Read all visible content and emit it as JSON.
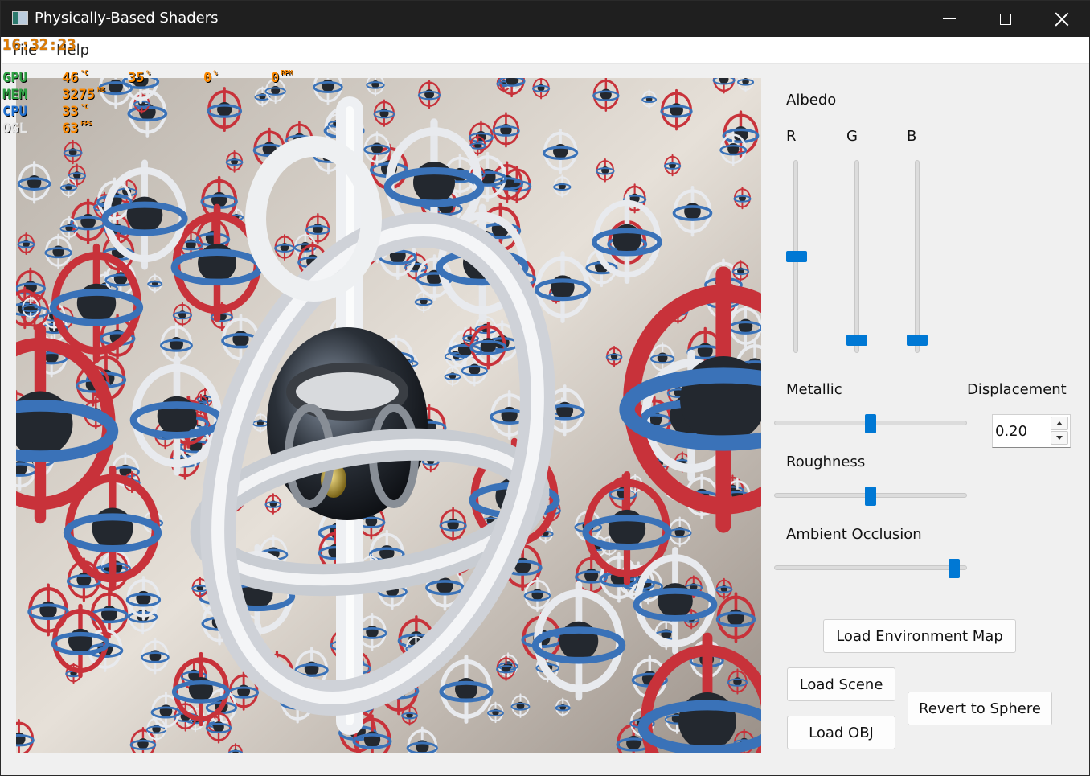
{
  "window": {
    "title": "Physically-Based Shaders"
  },
  "menu": {
    "file": "File",
    "help": "Help"
  },
  "overlay": {
    "clock": "16:32:23",
    "rows": [
      {
        "label": "GPU",
        "label_color": "#2ea043",
        "values": [
          {
            "v": "46",
            "u": "°C"
          },
          {
            "v": "35",
            "u": "%"
          },
          {
            "v": "0",
            "u": "%"
          },
          {
            "v": "0",
            "u": "RPM"
          }
        ]
      },
      {
        "label": "MEM",
        "label_color": "#2ea043",
        "values": [
          {
            "v": "3275",
            "u": "MB"
          }
        ]
      },
      {
        "label": "CPU",
        "label_color": "#1e6fd0",
        "values": [
          {
            "v": "33",
            "u": "°C"
          }
        ]
      },
      {
        "label": "OGL",
        "label_color": "#e6e6e6",
        "values": [
          {
            "v": "63",
            "u": "FPS"
          }
        ]
      }
    ]
  },
  "controls": {
    "albedo_label": "Albedo",
    "r_label": "R",
    "g_label": "G",
    "b_label": "B",
    "albedo": {
      "r": 0.5,
      "g": 0.04,
      "b": 0.04
    },
    "metallic_label": "Metallic",
    "metallic_value": 0.5,
    "displacement_label": "Displacement",
    "displacement_value": "0.20",
    "roughness_label": "Roughness",
    "roughness_value": 0.5,
    "ao_label": "Ambient Occlusion",
    "ao_value": 0.96
  },
  "buttons": {
    "load_env": "Load Environment Map",
    "load_scene": "Load Scene",
    "load_obj": "Load OBJ",
    "revert": "Revert to Sphere"
  },
  "colors": {
    "accent": "#0078d4",
    "ring_red": "#c8323a",
    "ring_white": "#e8eaee",
    "ring_blue": "#3a72b8"
  }
}
